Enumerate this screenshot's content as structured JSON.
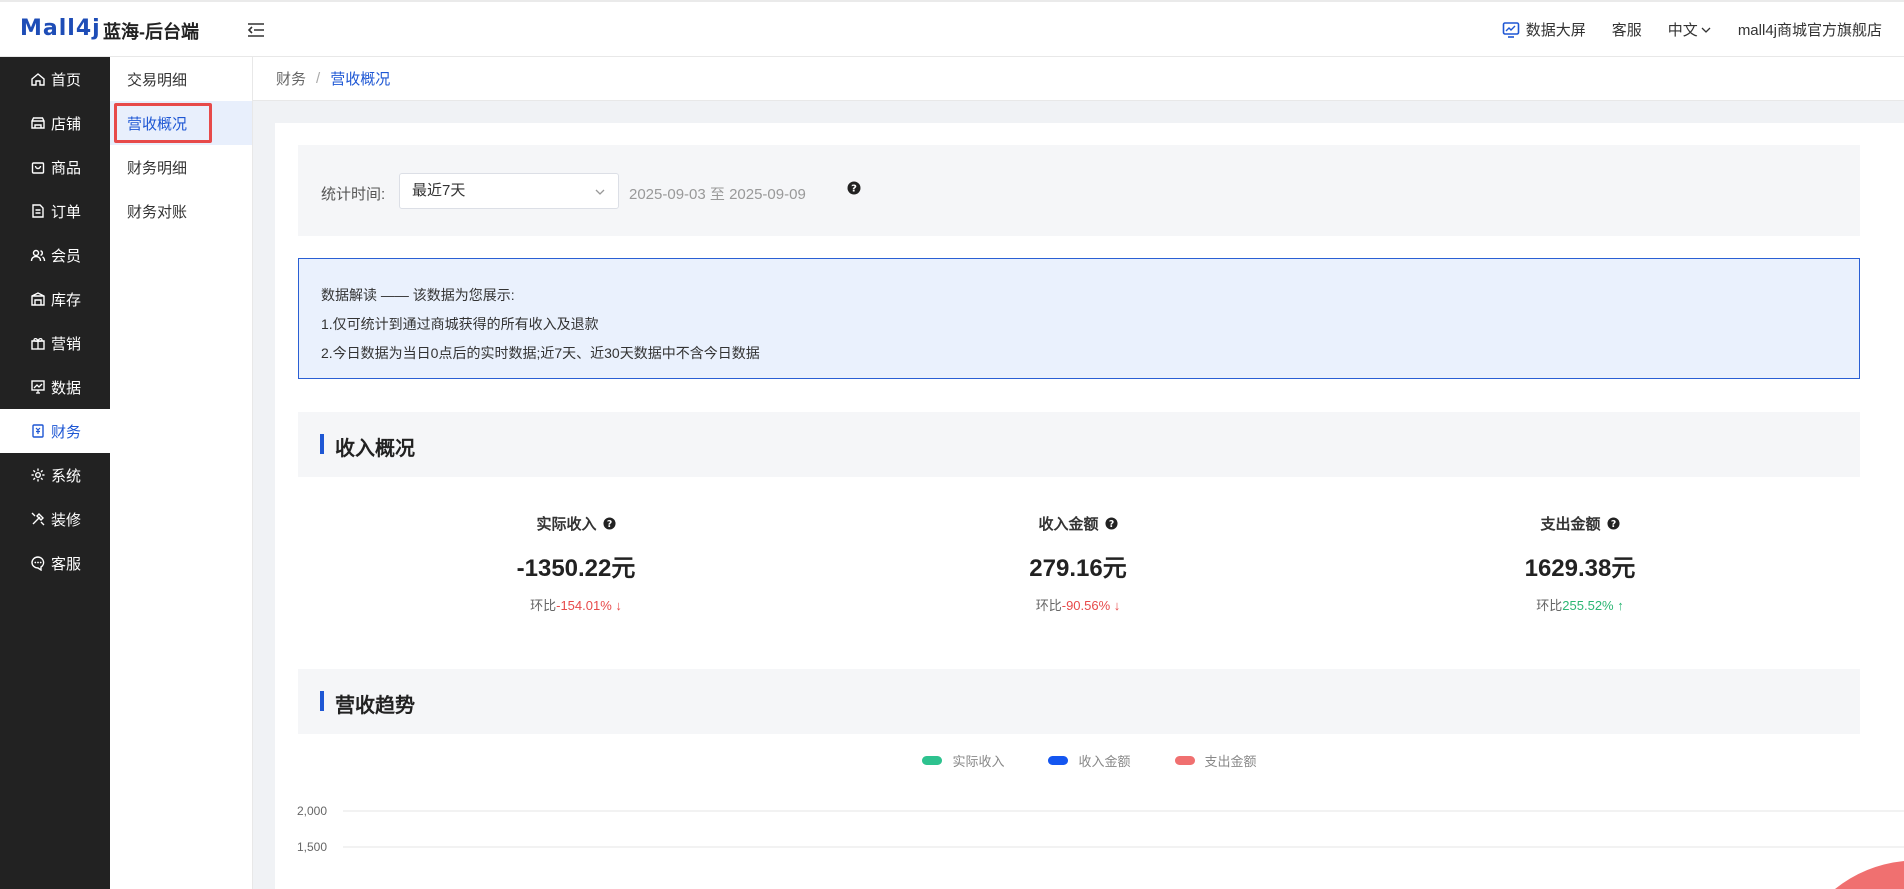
{
  "header": {
    "logo": "Mall4j",
    "brand": "蓝海-后台端",
    "data_screen": "数据大屏",
    "service": "客服",
    "language": "中文",
    "shop_name": "mall4j商城官方旗舰店"
  },
  "sidebar": {
    "items": [
      {
        "label": "首页",
        "icon": "home-icon"
      },
      {
        "label": "店铺",
        "icon": "store-icon"
      },
      {
        "label": "商品",
        "icon": "bag-icon"
      },
      {
        "label": "订单",
        "icon": "order-icon"
      },
      {
        "label": "会员",
        "icon": "member-icon"
      },
      {
        "label": "库存",
        "icon": "warehouse-icon"
      },
      {
        "label": "营销",
        "icon": "gift-icon"
      },
      {
        "label": "数据",
        "icon": "chart-board-icon"
      },
      {
        "label": "财务",
        "icon": "finance-icon",
        "active": true
      },
      {
        "label": "系统",
        "icon": "gear-icon"
      },
      {
        "label": "装修",
        "icon": "decorate-icon"
      },
      {
        "label": "客服",
        "icon": "chat-icon"
      }
    ]
  },
  "submenu": {
    "items": [
      "交易明细",
      "营收概况",
      "财务明细",
      "财务对账"
    ],
    "active_index": 1
  },
  "breadcrumb": {
    "parent": "财务",
    "separator": "/",
    "current": "营收概况"
  },
  "filter": {
    "label": "统计时间:",
    "select_value": "最近7天",
    "date_range": "2025-09-03 至 2025-09-09"
  },
  "notice": {
    "line1": "数据解读 —— 该数据为您展示:",
    "line2": "1.仅可统计到通过商城获得的所有收入及退款",
    "line3": "2.今日数据为当日0点后的实时数据;近7天、近30天数据中不含今日数据"
  },
  "income_section": {
    "title": "收入概况",
    "stats": [
      {
        "label": "实际收入",
        "value": "-1350.22元",
        "change_prefix": "环比",
        "change": "-154.01%",
        "direction": "down"
      },
      {
        "label": "收入金额",
        "value": "279.16元",
        "change_prefix": "环比",
        "change": "-90.56%",
        "direction": "down"
      },
      {
        "label": "支出金额",
        "value": "1629.38元",
        "change_prefix": "环比",
        "change": "255.52%",
        "direction": "up"
      }
    ]
  },
  "trend_section": {
    "title": "营收趋势"
  },
  "chart_data": {
    "type": "line",
    "series": [
      {
        "name": "实际收入",
        "color": "#2ec28f"
      },
      {
        "name": "收入金额",
        "color": "#1456f0"
      },
      {
        "name": "支出金额",
        "color": "#f07070"
      }
    ],
    "y_ticks": [
      "2,000",
      "1,500"
    ],
    "ylim": [
      0,
      2000
    ]
  },
  "colors": {
    "accent": "#1e57d4",
    "sidebar_bg": "#222222",
    "down": "#e74a4a",
    "up": "#2bb673"
  }
}
